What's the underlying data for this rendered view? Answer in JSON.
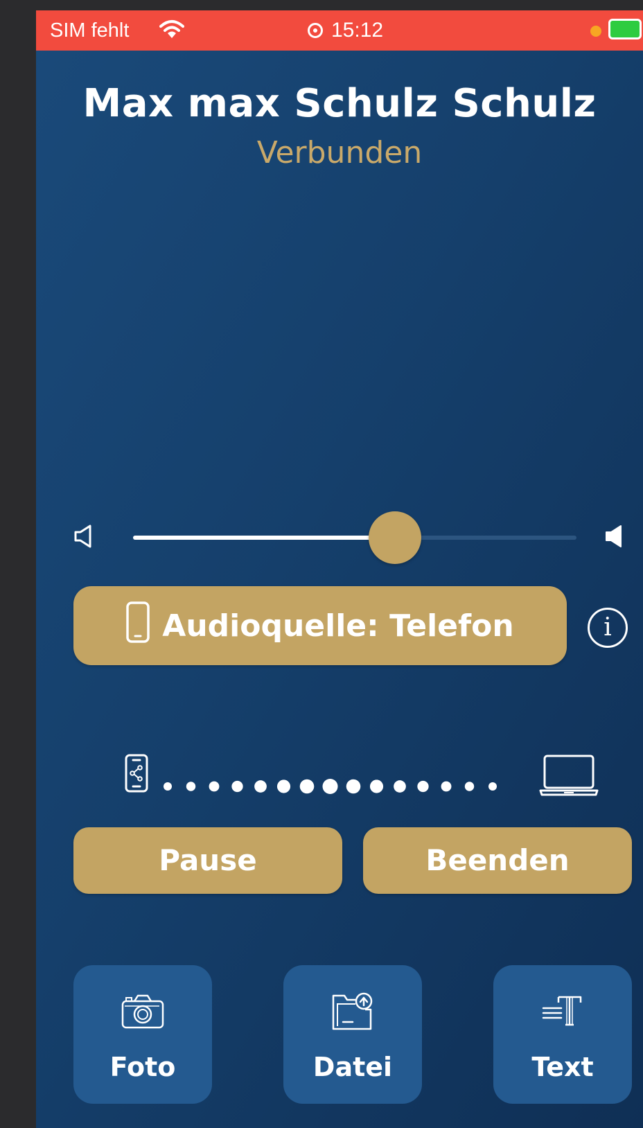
{
  "status_bar": {
    "carrier": "SIM fehlt",
    "time": "15:12",
    "battery_color": "#2ecc40",
    "recording_dot_color": "#f7a623",
    "bar_color": "#f24b3e"
  },
  "call": {
    "name": "Max max Schulz Schulz",
    "status": "Verbunden"
  },
  "volume": {
    "level": 0.59,
    "low_icon": "speaker-low-icon",
    "high_icon": "speaker-high-icon"
  },
  "audio_source": {
    "label": "Audioquelle: Telefon",
    "icon": "phone-icon",
    "info_icon": "info-icon"
  },
  "connection": {
    "from_icon": "phone-share-icon",
    "to_icon": "laptop-icon",
    "dot_count": 15
  },
  "controls": {
    "pause_label": "Pause",
    "end_label": "Beenden"
  },
  "share": {
    "items": [
      {
        "label": "Foto",
        "icon": "camera-icon"
      },
      {
        "label": "Datei",
        "icon": "file-upload-icon"
      },
      {
        "label": "Text",
        "icon": "text-icon"
      }
    ]
  },
  "colors": {
    "accent": "#c3a463",
    "background": "#153f6b",
    "tile": "#245a90",
    "status_text": "#c9a96a"
  }
}
